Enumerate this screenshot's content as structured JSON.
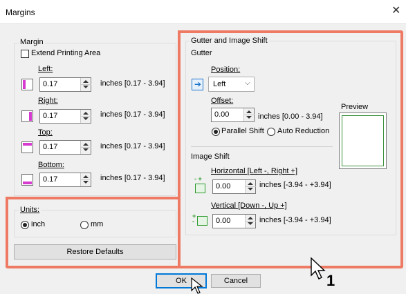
{
  "window": {
    "title": "Margins"
  },
  "margin_group": {
    "legend": "Margin",
    "extend_printing_area": "Extend Printing Area",
    "left": {
      "label": "Left:",
      "value": "0.17",
      "range": "inches [0.17 - 3.94]"
    },
    "right": {
      "label": "Right:",
      "value": "0.17",
      "range": "inches [0.17 - 3.94]"
    },
    "top": {
      "label": "Top:",
      "value": "0.17",
      "range": "inches [0.17 - 3.94]"
    },
    "bottom": {
      "label": "Bottom:",
      "value": "0.17",
      "range": "inches [0.17 - 3.94]"
    }
  },
  "units_group": {
    "legend": "Units:",
    "inch": "inch",
    "mm": "mm",
    "selected": "inch"
  },
  "restore_defaults": "Restore Defaults",
  "gutter_group": {
    "legend": "Gutter and Image Shift",
    "gutter_heading": "Gutter",
    "position_label": "Position:",
    "position_value": "Left",
    "offset_label": "Offset:",
    "offset_value": "0.00",
    "offset_range": "inches [0.00 - 3.94]",
    "parallel_shift": "Parallel Shift",
    "auto_reduction": "Auto Reduction",
    "selected_mode": "Parallel Shift",
    "preview_label": "Preview",
    "image_shift_heading": "Image Shift",
    "horizontal_label": "Horizontal [Left -, Right +]",
    "horizontal_value": "0.00",
    "horizontal_range": "inches [-3.94 - +3.94]",
    "vertical_label": "Vertical [Down -, Up +]",
    "vertical_value": "0.00",
    "vertical_range": "inches [-3.94 - +3.94]"
  },
  "footer": {
    "ok": "OK",
    "cancel": "Cancel"
  },
  "annotation": {
    "step_number": "1"
  },
  "colors": {
    "highlight": "#ee7a63",
    "left_margin_bar": "#d63bd0",
    "preview_border": "#3a8f3a",
    "gutter_icon": "#1a73c9",
    "shift_icon": "#2e9b2e"
  },
  "icons": {
    "close": "close-icon",
    "pointer": "mouse-pointer-icon",
    "dropdown": "chevron-down-icon"
  }
}
